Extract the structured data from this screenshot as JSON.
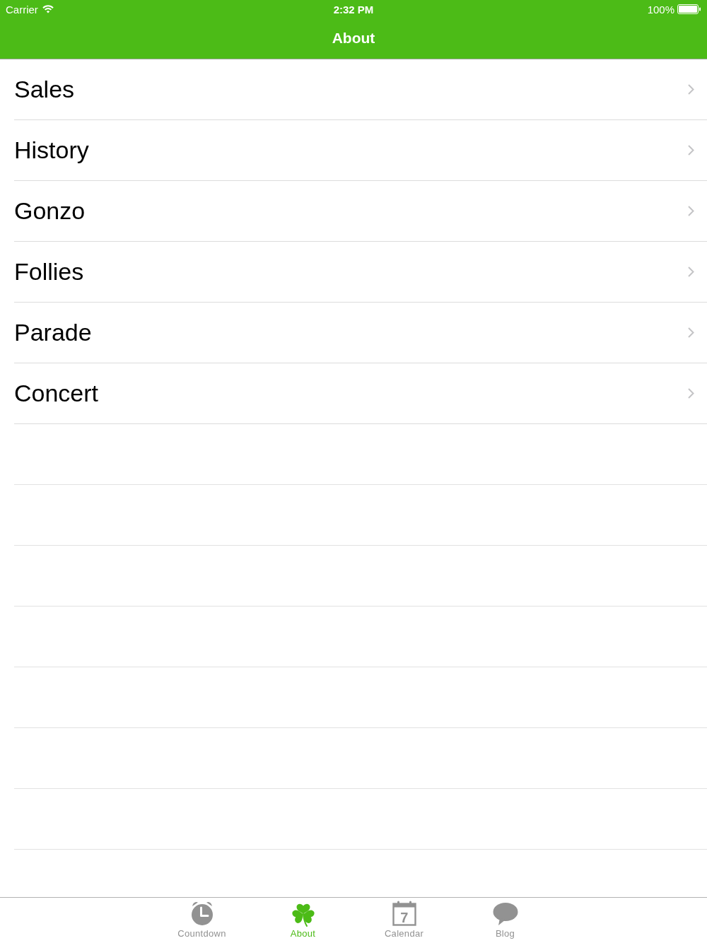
{
  "status_bar": {
    "carrier": "Carrier",
    "time": "2:32 PM",
    "battery": "100%"
  },
  "nav_bar": {
    "title": "About"
  },
  "rows": [
    {
      "label": "Sales"
    },
    {
      "label": "History"
    },
    {
      "label": "Gonzo"
    },
    {
      "label": "Follies"
    },
    {
      "label": "Parade"
    },
    {
      "label": "Concert"
    }
  ],
  "tab_bar": {
    "tabs": [
      {
        "label": "Countdown",
        "kind": "clock",
        "selected": false
      },
      {
        "label": "About",
        "kind": "shamrock",
        "selected": true
      },
      {
        "label": "Calendar",
        "kind": "calendar",
        "selected": false,
        "icon_text": "7"
      },
      {
        "label": "Blog",
        "kind": "chat",
        "selected": false
      }
    ]
  }
}
